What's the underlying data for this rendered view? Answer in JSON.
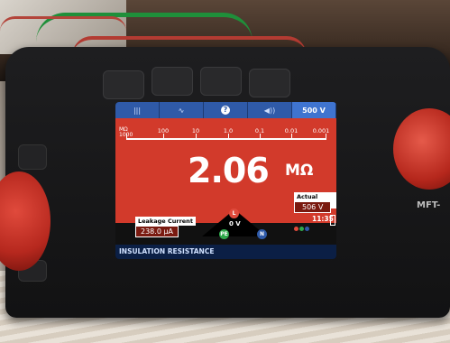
{
  "tabs": [
    {
      "label": "|||",
      "icon": "bars-icon"
    },
    {
      "label": "∿",
      "icon": "wave-icon"
    },
    {
      "label": "?",
      "icon": "help-icon"
    },
    {
      "label": "◀))",
      "icon": "sound-icon"
    },
    {
      "label": "500 V",
      "icon": ""
    }
  ],
  "scale": {
    "unit_top": "MΩ",
    "unit_bottom": "1000",
    "labels": [
      "100",
      "10",
      "1.0",
      "0.1",
      "0.01",
      "0.001"
    ]
  },
  "reading": {
    "value": "2.06",
    "unit": "MΩ"
  },
  "leakage": {
    "title": "Leakage Current",
    "value": "238.0 µA"
  },
  "actual_voltage": {
    "title": "Actual Voltage",
    "value": "506 V"
  },
  "terminals": {
    "l": "L",
    "pe": "PE",
    "n": "N",
    "voltage": "0 V"
  },
  "time": "11:35",
  "mode": "INSULATION RESISTANCE",
  "device_label": "MFT-",
  "colors": {
    "accent_red": "#d23a2b",
    "tab_blue": "#2f5aa8"
  }
}
